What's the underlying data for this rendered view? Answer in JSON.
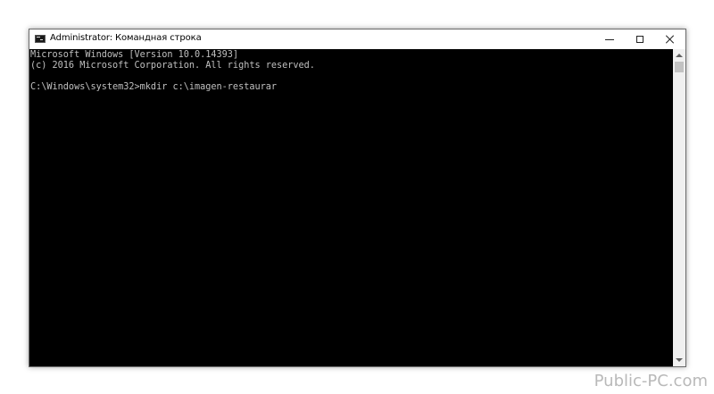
{
  "window": {
    "title": "Administrator: Командная строка",
    "icon": "cmd-icon",
    "controls": {
      "minimize": "minimize-icon",
      "maximize": "maximize-icon",
      "close": "close-icon"
    }
  },
  "console": {
    "lines": [
      "Microsoft Windows [Version 10.0.14393]",
      "(c) 2016 Microsoft Corporation. All rights reserved.",
      "C:\\Windows\\system32>mkdir c:\\imagen-restaurar"
    ],
    "text_color": "#c0c0c0",
    "background_color": "#000000"
  },
  "watermark": {
    "text": "Public-PC.com"
  }
}
